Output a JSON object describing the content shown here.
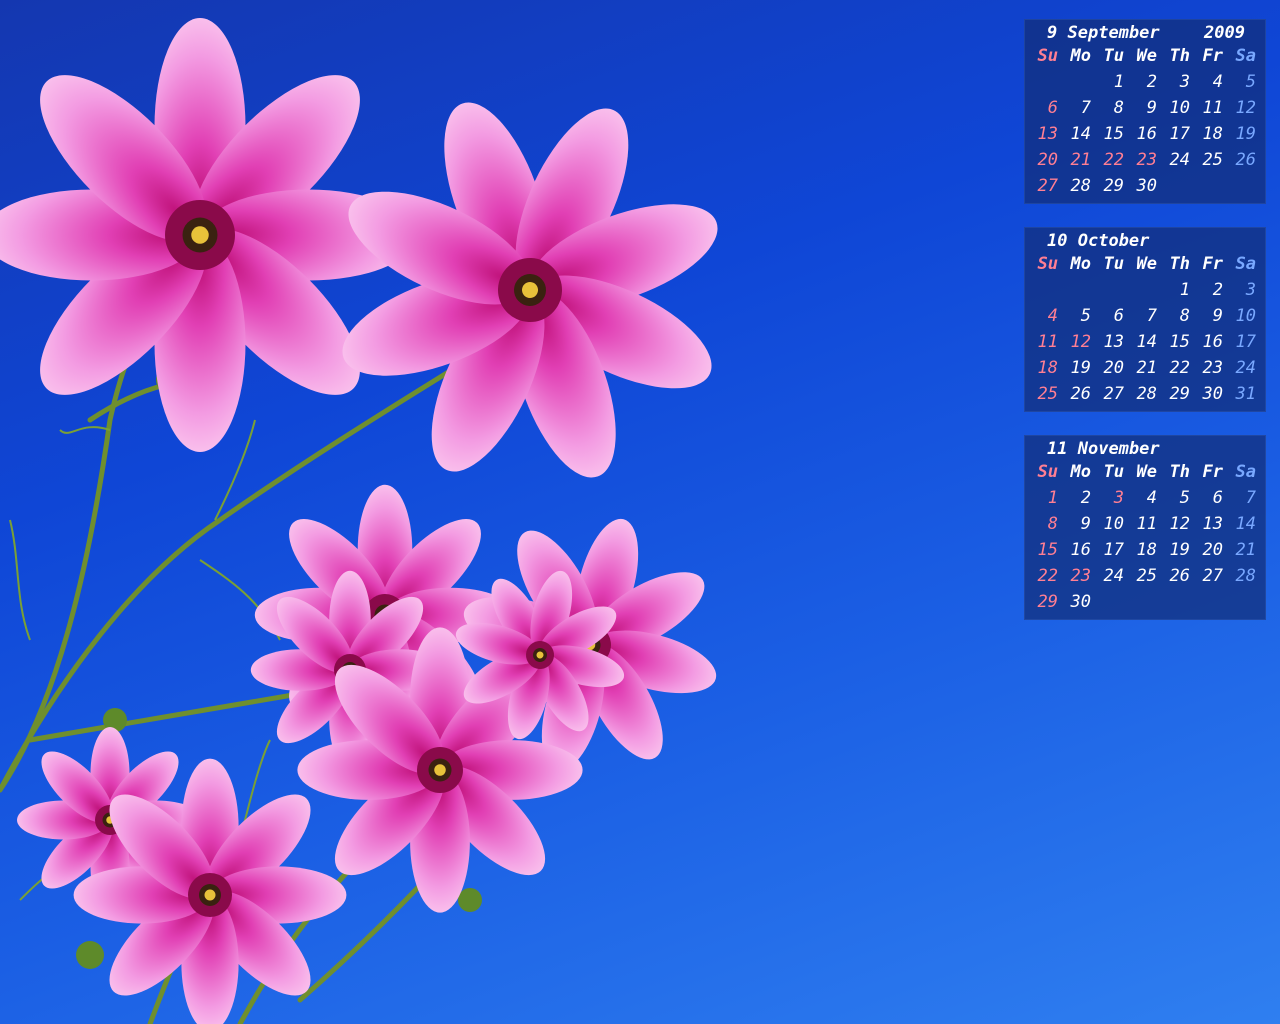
{
  "desktop": {
    "wallpaper": "pink-cosmos-flowers-blue-sky",
    "colors": {
      "sunday": "#ff7f93",
      "saturday": "#79a8ff",
      "text": "#ffffff",
      "panel": "#122e78"
    }
  },
  "calendar": {
    "year": "2009",
    "weekdays": [
      "Su",
      "Mo",
      "Tu",
      "We",
      "Th",
      "Fr",
      "Sa"
    ],
    "months": [
      {
        "number": "9",
        "name": "September",
        "weeks": [
          [
            "",
            "",
            "1",
            "2",
            "3",
            "4",
            "5"
          ],
          [
            "6",
            "7",
            "8",
            "9",
            "10",
            "11",
            "12"
          ],
          [
            "13",
            "14",
            "15",
            "16",
            "17",
            "18",
            "19"
          ],
          [
            "20",
            "21",
            "22",
            "23",
            "24",
            "25",
            "26"
          ],
          [
            "27",
            "28",
            "29",
            "30",
            "",
            "",
            ""
          ]
        ],
        "holidays": [
          "21",
          "22",
          "23"
        ]
      },
      {
        "number": "10",
        "name": "October",
        "weeks": [
          [
            "",
            "",
            "",
            "",
            "1",
            "2",
            "3"
          ],
          [
            "4",
            "5",
            "6",
            "7",
            "8",
            "9",
            "10"
          ],
          [
            "11",
            "12",
            "13",
            "14",
            "15",
            "16",
            "17"
          ],
          [
            "18",
            "19",
            "20",
            "21",
            "22",
            "23",
            "24"
          ],
          [
            "25",
            "26",
            "27",
            "28",
            "29",
            "30",
            "31"
          ]
        ],
        "holidays": [
          "12"
        ]
      },
      {
        "number": "11",
        "name": "November",
        "weeks": [
          [
            "1",
            "2",
            "3",
            "4",
            "5",
            "6",
            "7"
          ],
          [
            "8",
            "9",
            "10",
            "11",
            "12",
            "13",
            "14"
          ],
          [
            "15",
            "16",
            "17",
            "18",
            "19",
            "20",
            "21"
          ],
          [
            "22",
            "23",
            "24",
            "25",
            "26",
            "27",
            "28"
          ],
          [
            "29",
            "30",
            "",
            "",
            "",
            "",
            ""
          ]
        ],
        "holidays": [
          "3",
          "23"
        ]
      }
    ]
  }
}
